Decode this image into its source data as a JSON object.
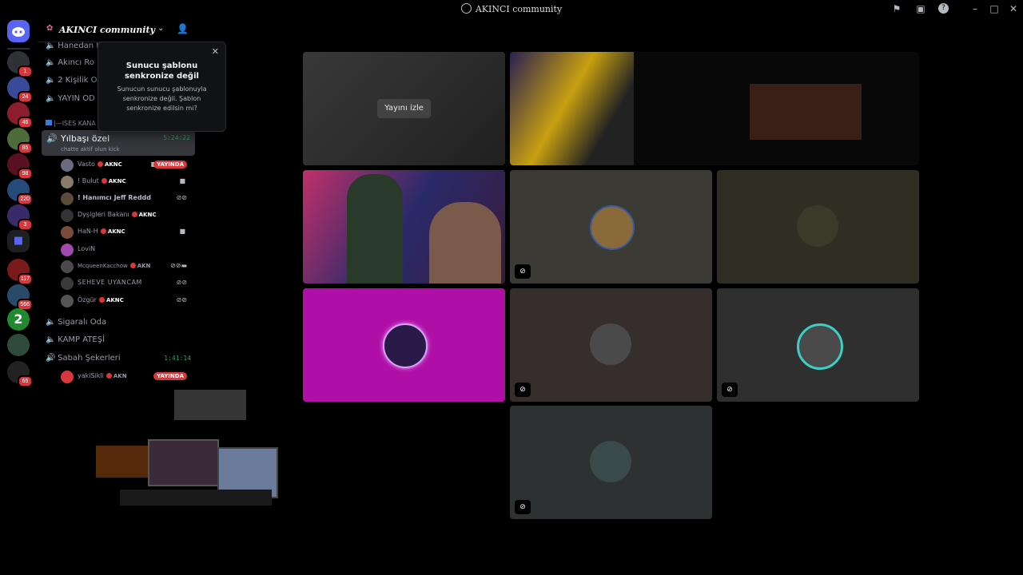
{
  "window": {
    "title": "AKINCI community",
    "icons": [
      "flag-icon",
      "screen-share-icon",
      "help-icon"
    ],
    "controls": [
      "minimize",
      "maximize",
      "close"
    ]
  },
  "rail_badges": [
    "1",
    "24",
    "46",
    "85",
    "98",
    "220",
    "3",
    "117",
    "566",
    "65"
  ],
  "server": {
    "name": "AKINCI community"
  },
  "channels": {
    "top": [
      "Hanedan K",
      "Akıncı Ro",
      "2 Kişilik O",
      "YAYIN OD"
    ],
    "category": "|—ISES KANA",
    "active": {
      "name": "Yılbaşı özel",
      "timer": "5:24:22",
      "status": "chatte aktif olun kick"
    },
    "users": [
      {
        "name": "Vasto",
        "tag": "AKNC",
        "live": "YAYINDA"
      },
      {
        "name": "! Bulut",
        "tag": "AKNC"
      },
      {
        "name": "! Hanımcı Jeff Reddd"
      },
      {
        "name": "Dyşigleri Bakanı",
        "tag": "AKNC"
      },
      {
        "name": "HaN-H",
        "tag": "AKNC"
      },
      {
        "name": "LoviN"
      },
      {
        "name": "McqueenKacchow",
        "tag": "AKN"
      },
      {
        "name": "SEHEVE UYANCAM"
      },
      {
        "name": "Özgür",
        "tag": "AKNC"
      }
    ],
    "after": [
      "Sigaralı Oda",
      "KAMP ATEŞİ"
    ],
    "sabah": {
      "name": "Sabah Şekerleri",
      "timer": "1:41:14",
      "user": "yakiSikli",
      "user_tag": "AKN",
      "live": "YAYINDA"
    }
  },
  "popup": {
    "title": "Sunucu şablonu senkronize değil",
    "description": "Sunucun sunucu şablonuyla senkronize değil. Şablon senkronize edilsin mi?"
  },
  "stage": {
    "watch_stream": "Yayını izle"
  },
  "colors": {
    "live_red": "#da373c",
    "voice_green": "#23a559",
    "pink_tile": "#b00fa7"
  }
}
